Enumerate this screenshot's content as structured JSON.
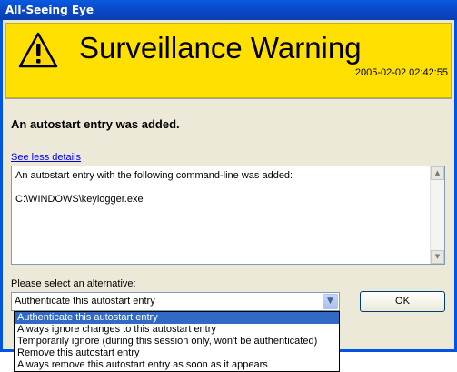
{
  "window": {
    "title": "All-Seeing Eye"
  },
  "banner": {
    "icon": "warning-icon",
    "title": "Surveillance Warning",
    "timestamp": "2005-02-02 02:42:55",
    "color": "#ffe000"
  },
  "message": {
    "headline": "An autostart entry was added."
  },
  "details": {
    "toggle_link": "See less details",
    "text": "An autostart entry with the following command-line was added:\n\nC:\\WINDOWS\\keylogger.exe"
  },
  "alternative": {
    "prompt": "Please select an alternative:",
    "selected": "Authenticate this autostart entry",
    "options": [
      "Authenticate this autostart entry",
      "Always ignore changes to this autostart entry",
      "Temporarily ignore (during this session only, won't be authenticated)",
      "Remove this autostart entry",
      "Always remove this autostart entry as soon as it appears"
    ]
  },
  "buttons": {
    "ok": "OK"
  },
  "colors": {
    "titlebar": "#0a47c8",
    "selection": "#316ac5"
  }
}
